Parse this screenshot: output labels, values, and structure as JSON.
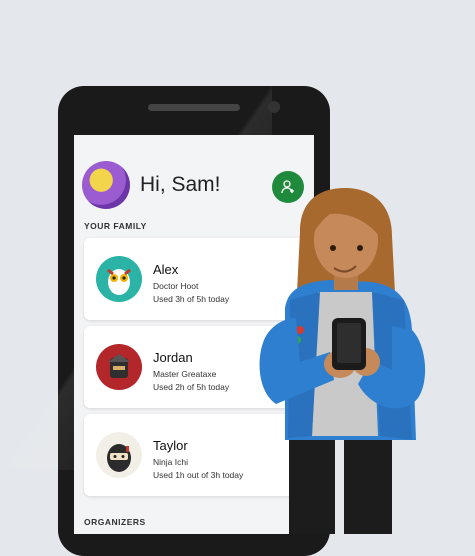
{
  "header": {
    "greeting": "Hi, Sam!"
  },
  "family": {
    "label": "YOUR FAMILY",
    "members": [
      {
        "name": "Alex",
        "gamertag": "Doctor Hoot",
        "usage": "Used 3h of 5h today",
        "avatar_icon": "owl-avatar-icon"
      },
      {
        "name": "Jordan",
        "gamertag": "Master Greataxe",
        "usage": "Used 2h of 5h today",
        "avatar_icon": "warrior-avatar-icon"
      },
      {
        "name": "Taylor",
        "gamertag": "Ninja Ichi",
        "usage": "Used 1h out of 3h today",
        "avatar_icon": "ninja-avatar-icon"
      }
    ]
  },
  "organizers": {
    "label": "ORGANIZERS"
  },
  "colors": {
    "accent_green": "#1f8a3c",
    "background": "#e4e7eb",
    "jacket_blue": "#2f7fd1",
    "hair_brown": "#a8692f"
  }
}
